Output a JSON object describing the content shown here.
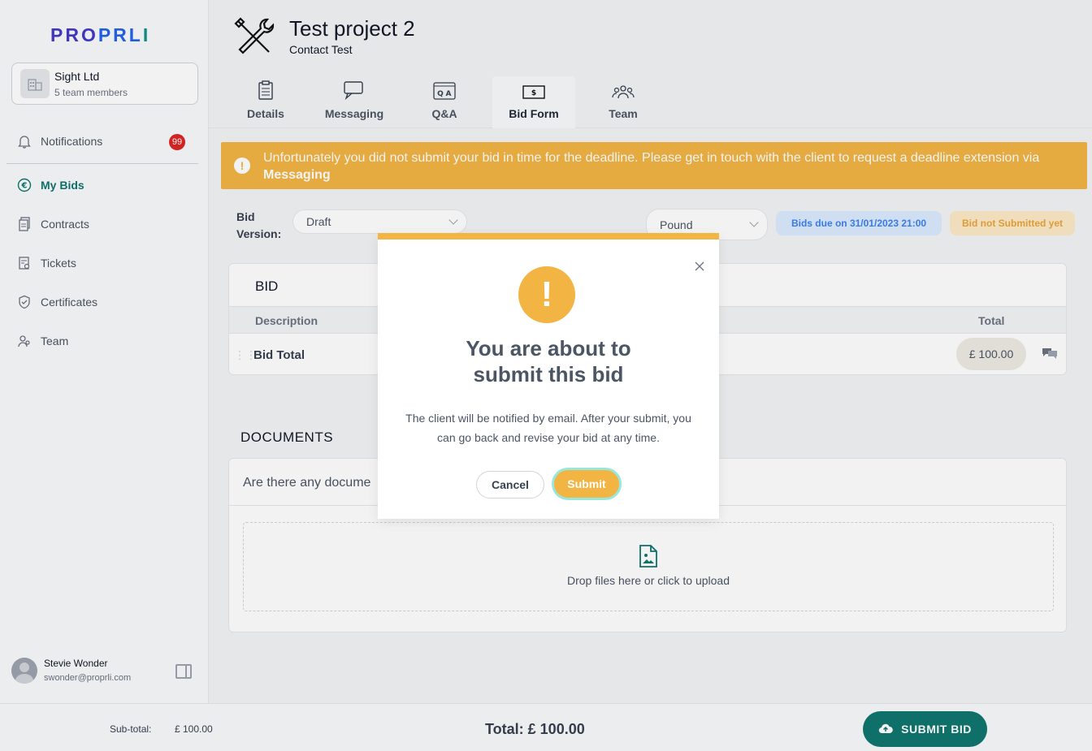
{
  "brand": {
    "logo_part1": "PRO",
    "logo_part2": "PRL",
    "logo_part3": "I"
  },
  "org": {
    "name": "Sight Ltd",
    "members": "5 team members"
  },
  "sidebar": {
    "items": [
      {
        "label": "Notifications",
        "icon": "bell-icon"
      },
      {
        "label": "My Bids",
        "icon": "euro-icon"
      },
      {
        "label": "Contracts",
        "icon": "document-icon"
      },
      {
        "label": "Tickets",
        "icon": "ticket-icon"
      },
      {
        "label": "Certificates",
        "icon": "shield-check-icon"
      },
      {
        "label": "Team",
        "icon": "team-icon"
      }
    ],
    "notification_count": "99"
  },
  "user": {
    "name": "Stevie Wonder",
    "email": "swonder@proprli.com"
  },
  "project": {
    "title": "Test project 2",
    "subtitle": "Contact Test"
  },
  "tabs": [
    {
      "label": "Details",
      "icon": "clipboard-icon"
    },
    {
      "label": "Messaging",
      "icon": "chat-icon"
    },
    {
      "label": "Q&A",
      "icon": "qa-icon"
    },
    {
      "label": "Bid Form",
      "icon": "money-icon"
    },
    {
      "label": "Team",
      "icon": "people-icon"
    }
  ],
  "alert": {
    "text": "Unfortunately you did not submit your bid in time for the deadline. Please get in touch with the client to request a deadline extension via",
    "link": "Messaging"
  },
  "bid_controls": {
    "version_label": "Bid Version:",
    "version_value": "Draft",
    "currency_value": "Pound",
    "due_pill": "Bids due on 31/01/2023 21:00",
    "status_pill": "Bid not Submitted yet"
  },
  "bid": {
    "title": "BID",
    "col_description": "Description",
    "col_total": "Total",
    "row_label": "Bid Total",
    "row_amount": "£ 100.00"
  },
  "documents": {
    "title": "DOCUMENTS",
    "question": "Are there any docume",
    "drop_text": "Drop files here or click to upload"
  },
  "footer": {
    "subtotal_label": "Sub-total:",
    "subtotal_value": "£ 100.00",
    "total": "Total: £ 100.00",
    "submit_label": "SUBMIT BID"
  },
  "modal": {
    "title": "You are about to submit this bid",
    "text": "The client will be notified by email. After your submit, you can go back and revise your bid at any time.",
    "cancel_label": "Cancel",
    "submit_label": "Submit"
  },
  "colors": {
    "accent": "#0f766e",
    "warning": "#f2b544",
    "badge": "#dc2626"
  }
}
